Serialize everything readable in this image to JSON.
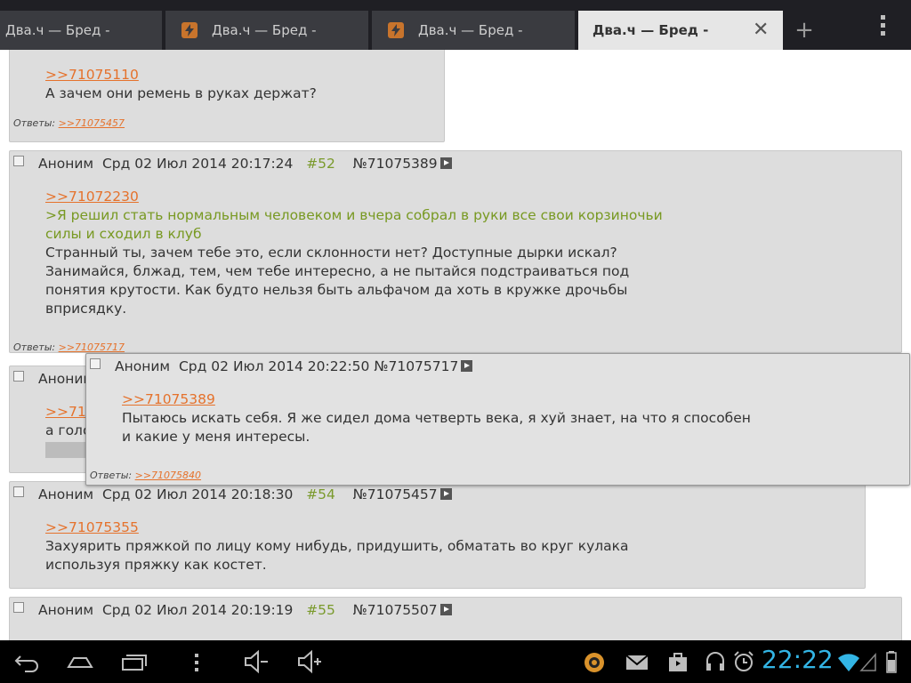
{
  "tabs": [
    {
      "label": "Два.ч — Бред -"
    },
    {
      "label": "Два.ч — Бред -"
    },
    {
      "label": "Два.ч — Бред -"
    },
    {
      "label": "Два.ч — Бред -"
    }
  ],
  "new_tab_label": "+",
  "close_tab_label": "✕",
  "posts": {
    "p0": {
      "quote_link": ">>71075110",
      "text": "А зачем они ремень в руках держат?",
      "replies_label": "Ответы:",
      "replies_link": ">>71075457"
    },
    "p52": {
      "author": "Аноним",
      "date": "Срд 02 Июл 2014 20:17:24",
      "number": "#52",
      "post_id": "№71075389",
      "quote_link": ">>71072230",
      "greentext": [
        ">Я решил стать нормальным человеком и вчера собрал в руки все свои корзиночьи",
        "силы и сходил в клуб"
      ],
      "lines": [
        "Странный ты, зачем тебе это, если склонности нет? Доступные дырки искал?",
        "Занимайся, блжад, тем, чем тебе интересно, а не пытайся подстраиваться под",
        "понятия крутости. Как будто нельзя быть альфачом да хоть в кружке дрочьбы",
        "вприсядку."
      ],
      "replies_label": "Ответы:",
      "replies_link": ">>71075717"
    },
    "p53": {
      "author": "Аноним",
      "quote_link_partial": ">>710",
      "text_partial": "а голо"
    },
    "popup": {
      "author": "Аноним",
      "date": "Срд 02 Июл 2014 20:22:50",
      "post_id": "№71075717",
      "quote_link": ">>71075389",
      "lines": [
        "Пытаюсь искать себя. Я же сидел дома четверть века, я хуй знает, на что я способен",
        "и какие у меня интересы."
      ],
      "replies_label": "Ответы:",
      "replies_link": ">>71075840"
    },
    "p54": {
      "author": "Аноним",
      "date": "Срд 02 Июл 2014 20:18:30",
      "number": "#54",
      "post_id": "№71075457",
      "quote_link": ">>71075355",
      "lines": [
        "Захуярить пряжкой по лицу кому нибудь, придушить, обматать во круг кулака",
        "используя пряжку как костет."
      ]
    },
    "p55": {
      "author": "Аноним",
      "date": "Срд 02 Июл 2014 20:19:19",
      "number": "#55",
      "post_id": "№71075507"
    }
  },
  "status": {
    "time": "22:22",
    "accent": "#33b5e5"
  },
  "colors": {
    "link": "#e5722c",
    "greentext": "#789922",
    "post_bg": "#dddddd",
    "post_number": "#7a9a2c"
  },
  "icons": [
    "back-icon",
    "home-icon",
    "recent-apps-icon",
    "menu-icon",
    "volume-down-icon",
    "volume-up-icon",
    "app-icon",
    "mail-icon",
    "shopping-bag-icon",
    "headset-icon",
    "alarm-icon",
    "wifi-icon",
    "signal-icon",
    "battery-icon"
  ]
}
